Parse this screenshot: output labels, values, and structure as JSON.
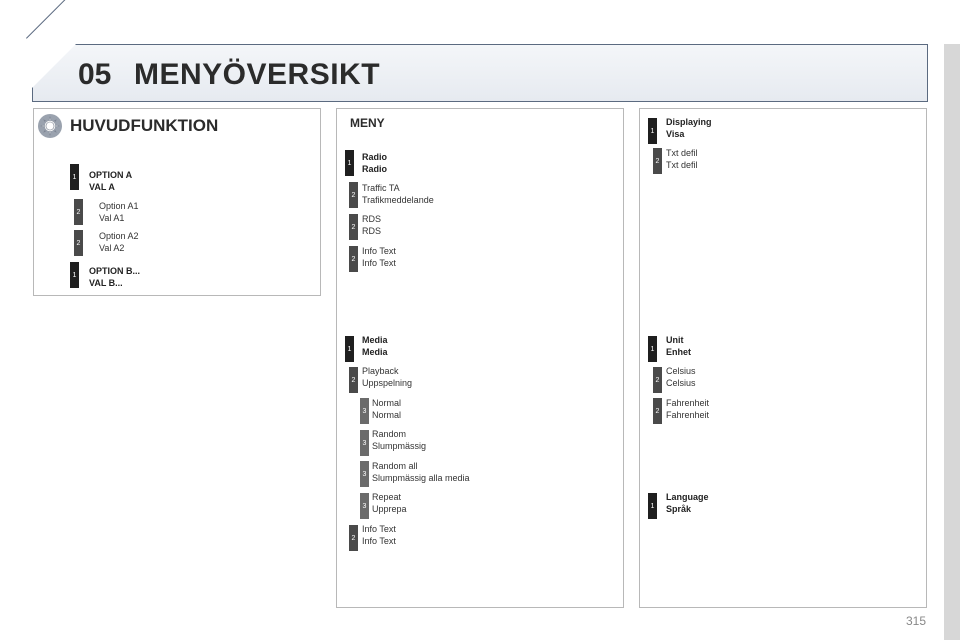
{
  "header": {
    "chapter": "05",
    "title": "MENYÖVERSIKT"
  },
  "main": {
    "title": "HUVUDFUNKTION",
    "items": [
      {
        "level": "1",
        "line1": "OPTION A",
        "line2": "VAL A"
      },
      {
        "level": "2",
        "line1": "Option A1",
        "line2": "Val A1"
      },
      {
        "level": "2",
        "line1": "Option A2",
        "line2": "Val A2"
      },
      {
        "level": "1",
        "line1": "OPTION B...",
        "line2": "VAL B..."
      }
    ]
  },
  "meny": {
    "title": "MENY",
    "items": [
      {
        "level": "1",
        "line1": "Radio",
        "line2": "Radio"
      },
      {
        "level": "2",
        "line1": "Traffic TA",
        "line2": "Trafikmeddelande"
      },
      {
        "level": "2",
        "line1": "RDS",
        "line2": "RDS"
      },
      {
        "level": "2",
        "line1": "Info Text",
        "line2": "Info Text"
      },
      {
        "level": "1",
        "line1": "Media",
        "line2": "Media"
      },
      {
        "level": "2",
        "line1": "Playback",
        "line2": "Uppspelning"
      },
      {
        "level": "3",
        "line1": "Normal",
        "line2": "Normal"
      },
      {
        "level": "3",
        "line1": "Random",
        "line2": "Slumpmässig"
      },
      {
        "level": "3",
        "line1": "Random all",
        "line2": "Slumpmässig alla media"
      },
      {
        "level": "3",
        "line1": "Repeat",
        "line2": "Upprepa"
      },
      {
        "level": "2",
        "line1": "Info Text",
        "line2": "Info Text"
      }
    ]
  },
  "right": {
    "items": [
      {
        "level": "1",
        "line1": "Displaying",
        "line2": "Visa"
      },
      {
        "level": "2",
        "line1": "Txt defil",
        "line2": "Txt defil"
      },
      {
        "level": "1",
        "line1": "Unit",
        "line2": "Enhet"
      },
      {
        "level": "2",
        "line1": "Celsius",
        "line2": "Celsius"
      },
      {
        "level": "2",
        "line1": "Fahrenheit",
        "line2": "Fahrenheit"
      },
      {
        "level": "1",
        "line1": "Language",
        "line2": "Språk"
      }
    ]
  },
  "page_number": "315",
  "colors": {
    "level1": "#1f1f1f",
    "level2": "#4a4a4a",
    "level3": "#6b6b6b",
    "frame": "#5b6a80"
  }
}
